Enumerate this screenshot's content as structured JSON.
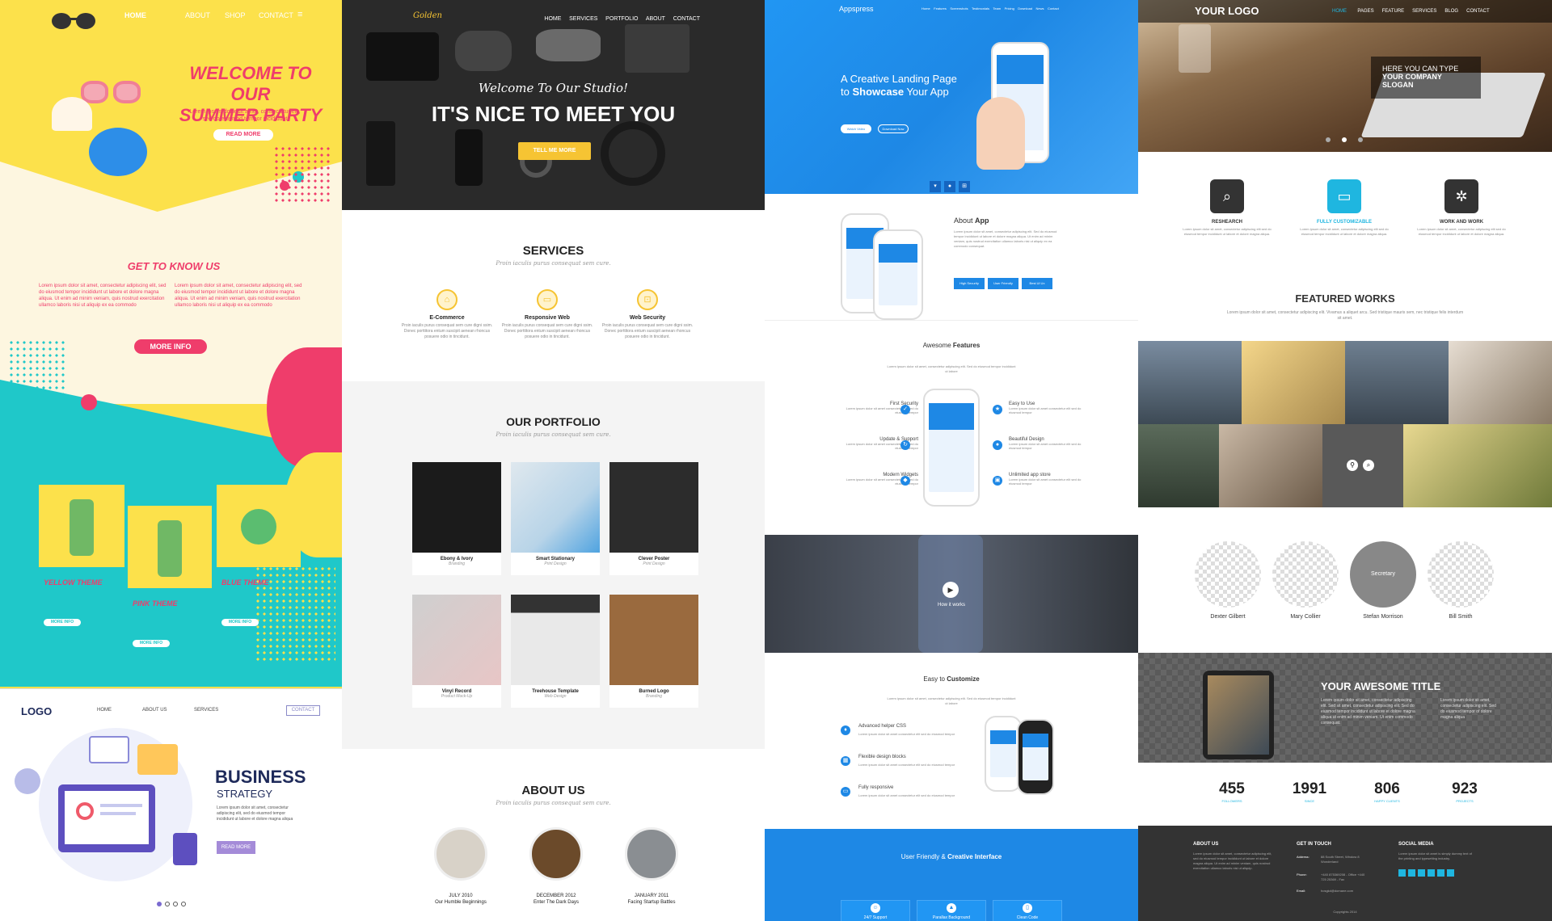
{
  "summer": {
    "nav": [
      "HOME",
      "ABOUT",
      "SHOP",
      "CONTACT"
    ],
    "hero_title_1": "WELCOME TO OUR",
    "hero_title_2": "SUMMER PARTY",
    "hero_text": "Lorem ipsum dolor sit amet, consectetur elit, sed do eiusmod tempor incididunt",
    "read_more": "READ MORE",
    "know_title": "GET TO KNOW US",
    "know_text": "Lorem ipsum dolor sit amet, consectetur adipiscing elit, sed do eiusmod tempor incididunt ut labore et dolore magna aliqua. Ut enim ad minim veniam, quis nostrud exercitation ullamco laboris nisi ut aliquip ex ea commodo",
    "more_info": "MORE INFO",
    "themes": [
      {
        "label": "YELLOW THEME",
        "button": "MORE INFO"
      },
      {
        "label": "PINK THEME",
        "button": "MORE INFO"
      },
      {
        "label": "BLUE THEME",
        "button": "MORE INFO"
      }
    ],
    "colors": {
      "yellow": "#fce14b",
      "teal": "#1fc8c9",
      "pink": "#ef3d6b",
      "cream": "#fdf6e0"
    }
  },
  "business": {
    "logo": "LOGO",
    "nav": [
      "HOME",
      "ABOUT US",
      "SERVICES"
    ],
    "contact": "CONTACT",
    "title": "BUSINESS",
    "subtitle": "STRATEGY",
    "text": "Lorem ipsum dolor sit amet, consectetur adipiscing elit, sed do eiusmod tempor incididunt ut labore et dolore magna aliqua",
    "button": "READ MORE"
  },
  "golden": {
    "logo": "Golden",
    "nav": [
      "HOME",
      "SERVICES",
      "PORTFOLIO",
      "ABOUT",
      "CONTACT"
    ],
    "welcome": "Welcome To Our Studio!",
    "headline": "IT'S NICE TO MEET YOU",
    "cta": "TELL ME MORE",
    "services_title": "SERVICES",
    "services_sub": "Proin iaculis purus consequat sem cure.",
    "services": [
      {
        "name": "E-Commerce",
        "text": "Proin iaculis purus consequat sem cure digni ssim. Donec porttitora entum suscipit aenean rhoncus posuere odio in tincidunt."
      },
      {
        "name": "Responsive Web",
        "text": "Proin iaculis purus consequat sem cure digni ssim. Donec porttitora entum suscipit aenean rhoncus posuere odio in tincidunt."
      },
      {
        "name": "Web Security",
        "text": "Proin iaculis purus consequat sem cure digni ssim. Donec porttitora entum suscipit aenean rhoncus posuere odio in tincidunt."
      }
    ],
    "portfolio_title": "OUR PORTFOLIO",
    "portfolio_sub": "Proin iaculis purus consequat sem cure.",
    "portfolio": [
      {
        "name": "Ebony & Ivory",
        "cat": "Branding"
      },
      {
        "name": "Smart Stationary",
        "cat": "Print Design"
      },
      {
        "name": "Clever Poster",
        "cat": "Print Design"
      },
      {
        "name": "Vinyl Record",
        "cat": "Product Mock-Up"
      },
      {
        "name": "Treehouse Template",
        "cat": "Web Design"
      },
      {
        "name": "Burned Logo",
        "cat": "Branding"
      }
    ],
    "about_title": "ABOUT US",
    "about_sub": "Proin iaculis purus consequat sem cure.",
    "timeline": [
      {
        "date": "JULY 2010",
        "title": "Our Humble Beginnings"
      },
      {
        "date": "DECEMBER 2012",
        "title": "Enter The Dark Days"
      },
      {
        "date": "JANUARY 2011",
        "title": "Facing Startup Battles"
      }
    ],
    "colors": {
      "accent": "#f6c433",
      "dark": "#222222"
    }
  },
  "apps": {
    "logo": "Appspress",
    "nav": [
      "Home",
      "Features",
      "Screenshots",
      "Testimonials",
      "Team",
      "Pricing",
      "Download",
      "News",
      "Contact"
    ],
    "hero_line1": "A Creative Landing Page",
    "hero_line2a": "to ",
    "hero_line2b": "Showcase",
    "hero_line2c": " Your App",
    "btn_watch": "Watch Video",
    "btn_download": "Download Now",
    "about_title_a": "About ",
    "about_title_b": "App",
    "about_text": "Lorem ipsum dolor sit amet, consectetur adipiscing elit. Sed do eiusmod tempor incididunt ut labore et dolore magna aliqua. Ut enim ad minim veniam, quis nostrud exercitation ullamco laboris nisi ut aliquip ex ea commodo consequat.",
    "about_buttons": [
      "High Security",
      "User Friendly",
      "Best Ui Ux"
    ],
    "features_title_a": "Awesome ",
    "features_title_b": "Features",
    "features_text": "Lorem ipsum dolor sit amet, consectetur adipiscing elit. Sed do eiusmod tempor incididunt ut labore",
    "features_left": [
      "First Security",
      "Update & Support",
      "Modern Widgets"
    ],
    "features_right": [
      "Easy to Use",
      "Beautiful Design",
      "Unlimited app store"
    ],
    "feature_text": "Lorem ipsum dolor sit amet consectetur elit sed do eiusmod tempor",
    "video_label": "How it works",
    "customize_title_a": "Easy to ",
    "customize_title_b": "Customize",
    "customize_text": "Lorem ipsum dolor sit amet, consectetur adipiscing elit. Sed do eiusmod tempor incididunt ut labore",
    "customize_items": [
      "Advanced helper CSS",
      "Flexible design blocks",
      "Fully responsive"
    ],
    "footer_title_a": "User Friendly & ",
    "footer_title_b": "Creative Interface",
    "footer_items": [
      "24/7 Support",
      "Parallax Background",
      "Clean Code"
    ],
    "colors": {
      "blue": "#1e88e5"
    }
  },
  "corporate": {
    "logo": "YOUR LOGO",
    "nav": [
      "HOME",
      "PAGES",
      "FEATURE",
      "SERVICES",
      "BLOG",
      "CONTACT"
    ],
    "slogan_1": "HERE YOU CAN TYPE",
    "slogan_2": "YOUR COMPANY",
    "slogan_3": "SLOGAN",
    "features": [
      {
        "title": "RESHEARCH",
        "text": "Lorem ipsum dolor sit amet, consectetur adipiscing elit sed do eiusmod tempor incididunt ut labore et dolore magna aliqua."
      },
      {
        "title": "FULLY CUSTOMIZABLE",
        "text": "Lorem ipsum dolor sit amet, consectetur adipiscing elit sed do eiusmod tempor incididunt ut labore et dolore magna aliqua."
      },
      {
        "title": "WORK AND WORK",
        "text": "Lorem ipsum dolor sit amet, consectetur adipiscing elit sed do eiusmod tempor incididunt ut labore et dolore magna aliqua."
      }
    ],
    "works_title": "FEATURED WORKS",
    "works_text": "Lorem ipsum dolor sit amet, consectetur adipiscing elit. Vivamus a aliquet arcu. Sed tristique mauris sem, nec tristique felis interdum sit amet.",
    "team": [
      {
        "name": "Dexter Gilbert",
        "role": ""
      },
      {
        "name": "Mary Collier",
        "role": ""
      },
      {
        "name": "Stefan Morrison",
        "role": "Secretary"
      },
      {
        "name": "Bill Smith",
        "role": ""
      }
    ],
    "awesome_title": "YOUR AWESOME TITLE",
    "awesome_text": "Lorem ipsum dolor sit amet, consectetur adipiscing elit. Sed sit amet, consectetur adipiscing elit. Sed do eiusmod tempor incididunt ut labore et dolore magna aliqua ut enim ad minim veniam. Ut enim commodo consequat.",
    "awesome_side": "Lorem ipsum dolor sit amet, consectetur adipiscing elit. Sed do eiusmod tempor of dolore magna aliqua",
    "stats": [
      {
        "value": "455",
        "label": "FOLLOWERS"
      },
      {
        "value": "1991",
        "label": "SINCE"
      },
      {
        "value": "806",
        "label": "HAPPY CLIENTS"
      },
      {
        "value": "923",
        "label": "PROJECTS"
      }
    ],
    "footer": {
      "about_title": "ABOUT US",
      "about_text": "Lorem ipsum dolor sit amet, consectetur adipiscing elit, sed do eiusmod tempor incididunt ut labore et dolore magna aliqua. Ut enim ad minim veniam, quis nostrud exercitation ullamco laboris nisi ut aliquip.",
      "touch_title": "GET IN TOUCH",
      "address_label": "Address:",
      "address_value": "88 South Street, Window 8 Wonderland",
      "phone_label": "Phone:",
      "phone_value": "+440 875369208 - Office +440 725 25369 - Fax",
      "email_label": "Email:",
      "email_value": "hosgkd@domane.com",
      "social_title": "SOCIAL MEDIA",
      "social_text": "Lorem ipsum dolor sit amet is simply dummy text of the printing and typesetting industry.",
      "copyright": "Copyrights 2014"
    },
    "colors": {
      "accent": "#1fb6e0",
      "dark": "#333333"
    }
  }
}
